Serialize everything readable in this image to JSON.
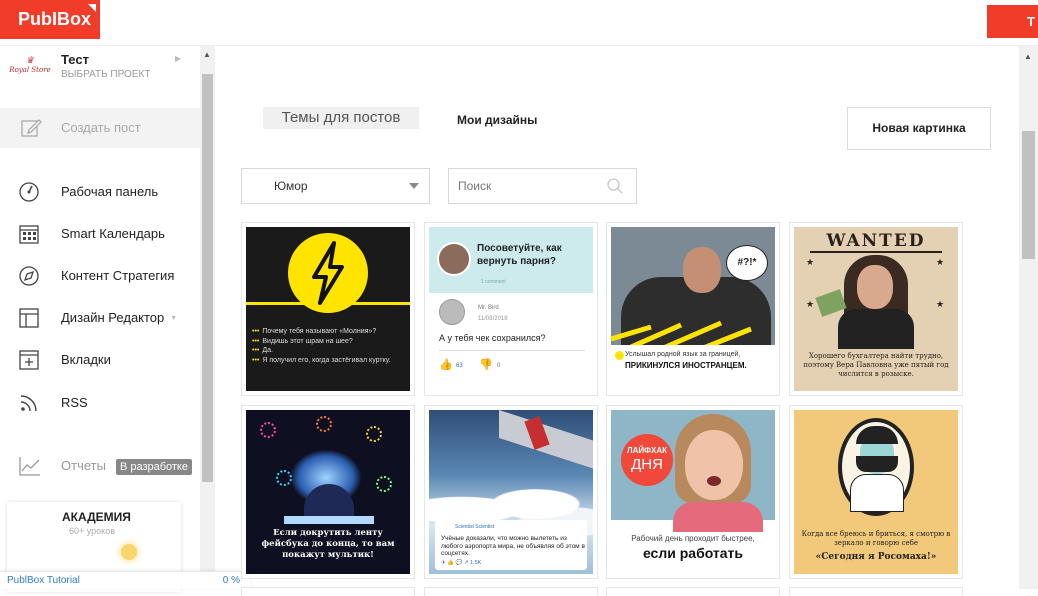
{
  "header": {
    "logo_text": "PubIBox",
    "cta_label": "Т"
  },
  "sidebar": {
    "project": {
      "logo_text": "Royal Store",
      "name": "Тест",
      "subtitle": "ВЫБРАТЬ ПРОЕКТ"
    },
    "create_post": "Создать пост",
    "items": [
      {
        "label": "Рабочая панель",
        "icon": "dashboard-icon"
      },
      {
        "label": "Smart Календарь",
        "icon": "calendar-icon"
      },
      {
        "label": "Контент Стратегия",
        "icon": "compass-icon"
      },
      {
        "label": "Дизайн Редактор",
        "icon": "layout-icon"
      },
      {
        "label": "Вкладки",
        "icon": "tab-add-icon"
      },
      {
        "label": "RSS",
        "icon": "rss-icon"
      }
    ],
    "reports": {
      "label": "Отчеты",
      "badge": "В разработке",
      "icon": "chart-icon"
    },
    "academy": {
      "title": "АКАДЕМИЯ",
      "subtitle": "60+ уроков"
    },
    "tutorial": {
      "label": "PublBox Tutorial",
      "progress": "0 %"
    }
  },
  "main": {
    "tabs": [
      {
        "label": "Темы для постов",
        "active": true
      },
      {
        "label": "Мои дизайны",
        "active": false
      }
    ],
    "new_picture_button": "Новая картинка",
    "category_select": {
      "value": "Юмор"
    },
    "search": {
      "placeholder": "Поиск"
    },
    "cards": [
      {
        "id": "lightning",
        "lines": [
          "Почему тебя называют «Молния»?",
          "Видишь этот шрам на шее?",
          "Да.",
          "Я получил его, когда застёгивал куртку."
        ]
      },
      {
        "id": "advice",
        "question": "Посоветуйте, как вернуть парня?",
        "comments": "1 comment",
        "author": "Mr. Bird",
        "date": "11/08/2018",
        "message": "А у тебя чек сохранился?",
        "likes": "63",
        "dislikes": "0"
      },
      {
        "id": "abroad",
        "bubble": "#?!*",
        "line1": "Услышал родной язык за границей,",
        "line2": "ПРИКИНУЛСЯ ИНОСТРАНЦЕМ."
      },
      {
        "id": "wanted",
        "title": "WANTED",
        "text": "Хорошего бухгалтера найти трудно, поэтому Вера Павловна уже пятый год числится в розыске."
      },
      {
        "id": "cartoon",
        "text": "Если докрутить ленту фейсбука до конца, то вам покажут мультик!"
      },
      {
        "id": "airport",
        "name": "Scientist Scientist",
        "text": "Учёные доказали, что можно вылететь из любого аэропорта мира, не объявляя об этом в соцсетях.",
        "icons": "✈ 👍 💬 ↗ 1.5K"
      },
      {
        "id": "lifehack",
        "badge_top": "ЛАЙФХАК",
        "badge_bottom": "ДНЯ",
        "line1": "Рабочий день проходит быстрее,",
        "line2": "если работать"
      },
      {
        "id": "wolverine",
        "line1": "Когда все бреюсь и бриться, я смотрю в зеркало и говорю себе",
        "line2": "«Сегодня я Росомаха!»"
      }
    ]
  },
  "colors": {
    "brand": "#f23c2a",
    "active_tab_bg": "#f0f0f0",
    "link_blue": "#2d7fc1"
  }
}
